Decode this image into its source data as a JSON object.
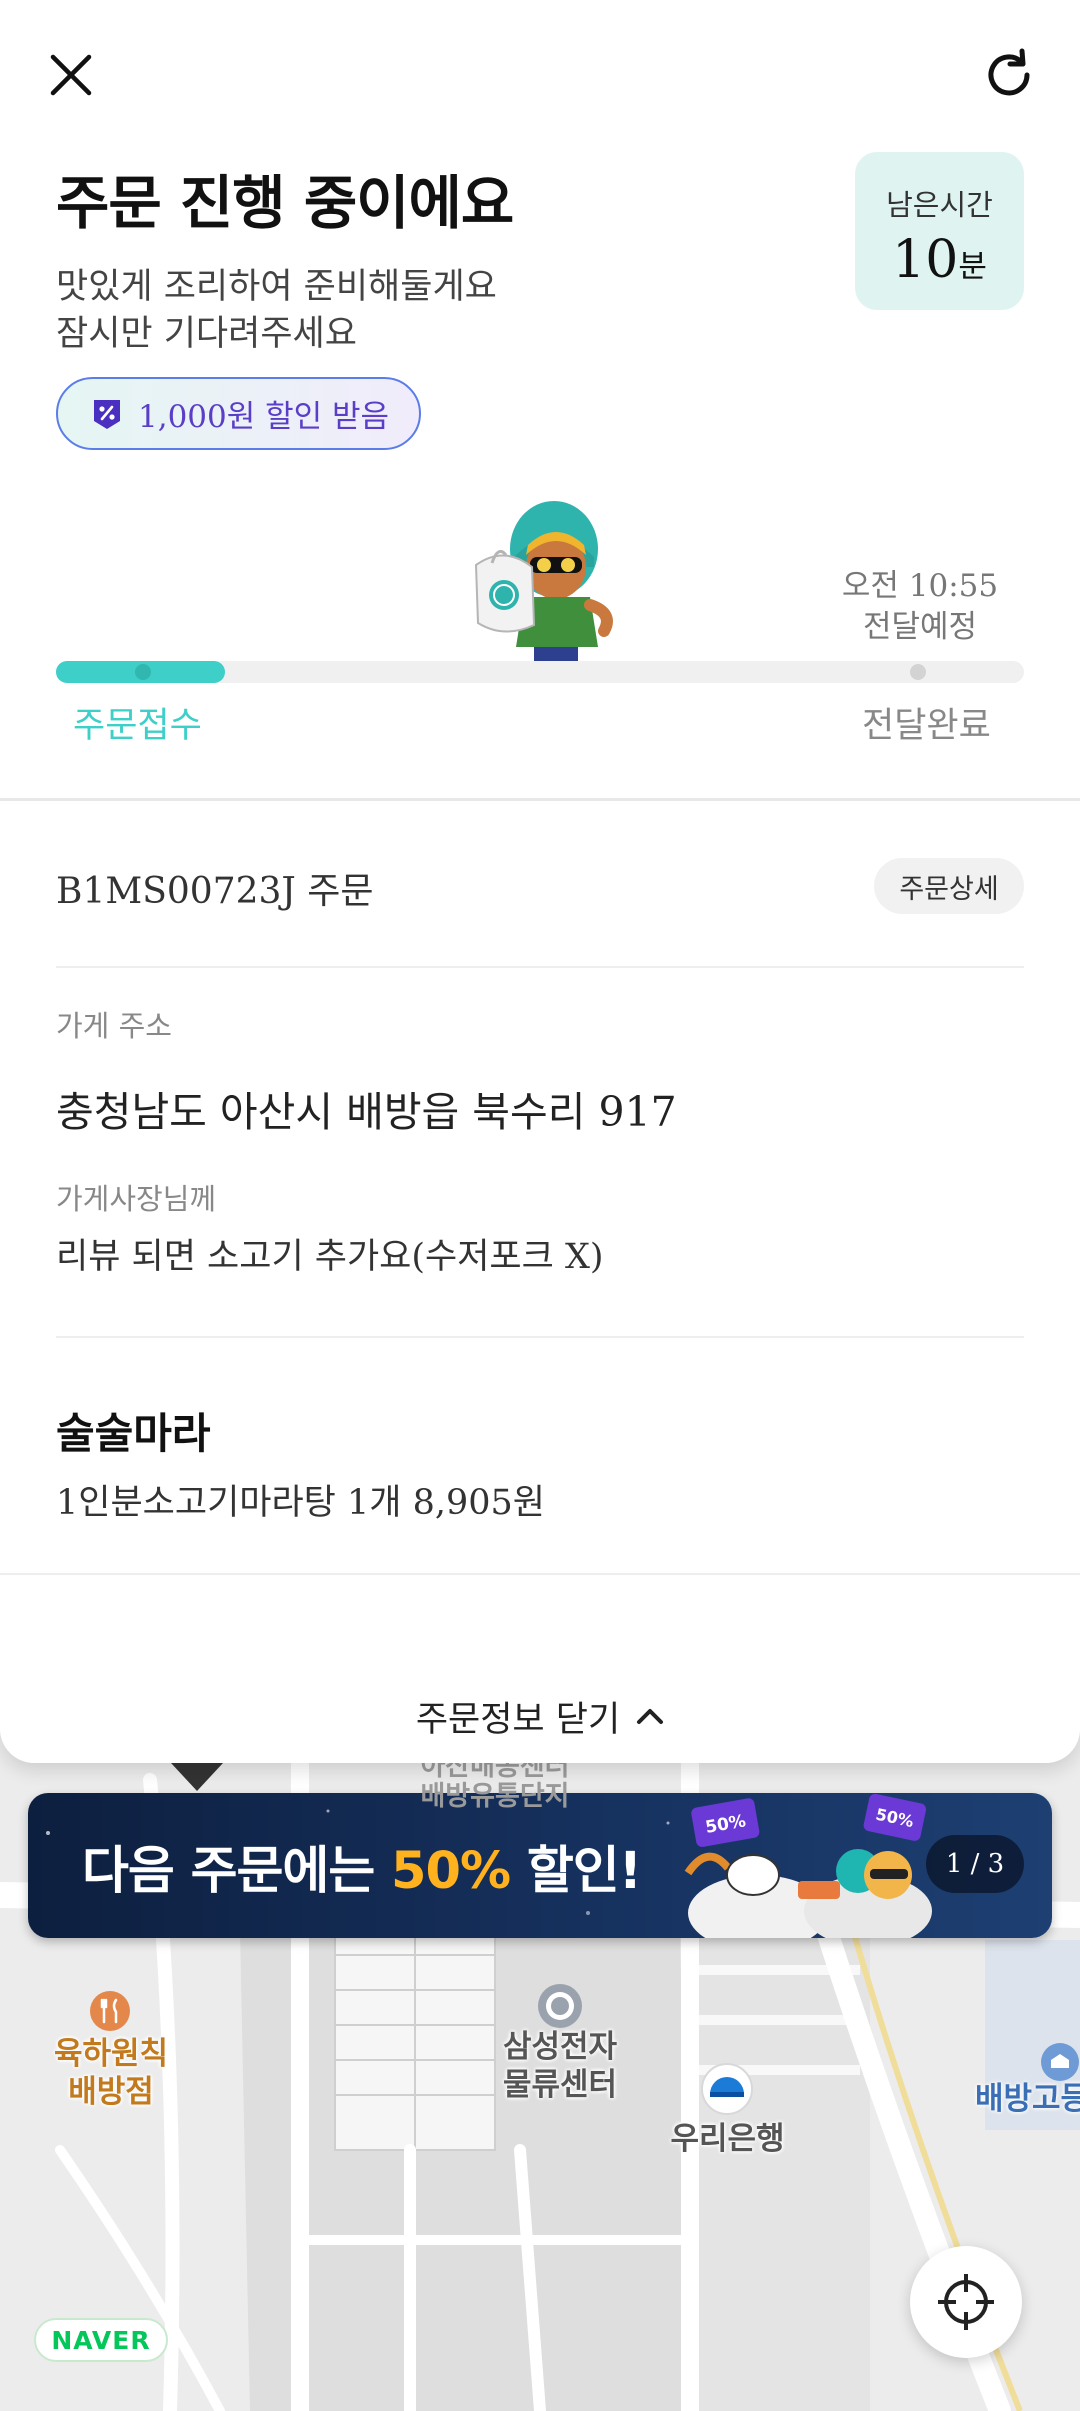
{
  "header": {
    "title": "주문 진행 중이에요",
    "subtitle_line1": "맛있게 조리하여 준비해둘게요",
    "subtitle_line2": "잠시만 기다려주세요",
    "discount_chip": "1,000원 할인 받음",
    "remaining_label": "남은시간",
    "remaining_value": "10",
    "remaining_unit": "분"
  },
  "progress": {
    "eta_time": "오전 10:55",
    "eta_label": "전달예정",
    "step_start": "주문접수",
    "step_end": "전달완료",
    "fill_fraction": 0.175,
    "accent_color": "#3ecfc9",
    "end_color": "#888888"
  },
  "order": {
    "number": "B1MS00723J 주문",
    "detail_button": "주문상세",
    "store_address_label": "가게 주소",
    "store_address": "충청남도 아산시 배방읍 북수리 917",
    "memo_label": "가게사장님께",
    "memo": "리뷰 되면 소고기 추가요(수저포크 X)",
    "store_name": "술술마라",
    "item": "1인분소고기마라탕 1개 8,905원",
    "collapse_button": "주문정보 닫기"
  },
  "banner": {
    "text_before": "다음 주문에는 ",
    "text_highlight": "50%",
    "text_after": " 할인!",
    "badge_text": "50%",
    "counter": "1 / 3",
    "highlight_color": "#ffb21e"
  },
  "map": {
    "poi_restaurant": [
      "육하원칙",
      "배방점"
    ],
    "poi_center": [
      "삼성전자",
      "물류센터"
    ],
    "poi_bank": "우리은행",
    "poi_school": "배방고등",
    "poi_faded": [
      "아산배송센터",
      "배방유통단지"
    ],
    "logo": "NAVER"
  }
}
